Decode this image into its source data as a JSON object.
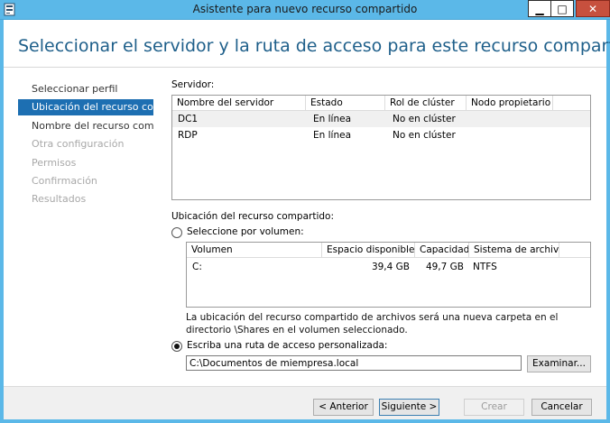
{
  "window": {
    "title": "Asistente para nuevo recurso compartido",
    "minimize_glyph": "▁",
    "maximize_glyph": "□",
    "close_glyph": "✕",
    "app_icon": "server-icon"
  },
  "header": {
    "title": "Seleccionar el servidor y la ruta de acceso para este recurso comparti..."
  },
  "nav": {
    "items": [
      {
        "label": "Seleccionar perfil",
        "state": "normal"
      },
      {
        "label": "Ubicación del recurso co...",
        "state": "active"
      },
      {
        "label": "Nombre del recurso com...",
        "state": "normal"
      },
      {
        "label": "Otra configuración",
        "state": "disabled"
      },
      {
        "label": "Permisos",
        "state": "disabled"
      },
      {
        "label": "Confirmación",
        "state": "disabled"
      },
      {
        "label": "Resultados",
        "state": "disabled"
      }
    ]
  },
  "server": {
    "label": "Servidor:",
    "columns": [
      "Nombre del servidor",
      "Estado",
      "Rol de clúster",
      "Nodo propietario"
    ],
    "rows": [
      [
        "DC1",
        "En línea",
        "No en clúster",
        ""
      ],
      [
        "RDP",
        "En línea",
        "No en clúster",
        ""
      ]
    ]
  },
  "location": {
    "label": "Ubicación del recurso compartido:",
    "by_volume_label": "Seleccione por volumen:",
    "by_volume_selected": false,
    "volume_columns": [
      "Volumen",
      "Espacio disponible",
      "Capacidad",
      "Sistema de archivos"
    ],
    "volume_rows": [
      [
        "C:",
        "39,4 GB",
        "49,7 GB",
        "NTFS"
      ]
    ],
    "info_text": "La ubicación del recurso compartido de archivos será una nueva carpeta en el directorio \\Shares en el volumen seleccionado.",
    "custom_path_label": "Escriba una ruta de acceso personalizada:",
    "custom_path_selected": true,
    "custom_path_value": "C:\\Documentos de miempresa.local",
    "browse_label": "Examinar..."
  },
  "footer": {
    "back_label": "< Anterior",
    "next_label": "Siguiente >",
    "create_label": "Crear",
    "cancel_label": "Cancelar"
  },
  "colors": {
    "titlebar": "#5bb8e8",
    "accent": "#1d6fb2",
    "header_title": "#1e5f8a",
    "close_button": "#c7503e"
  }
}
